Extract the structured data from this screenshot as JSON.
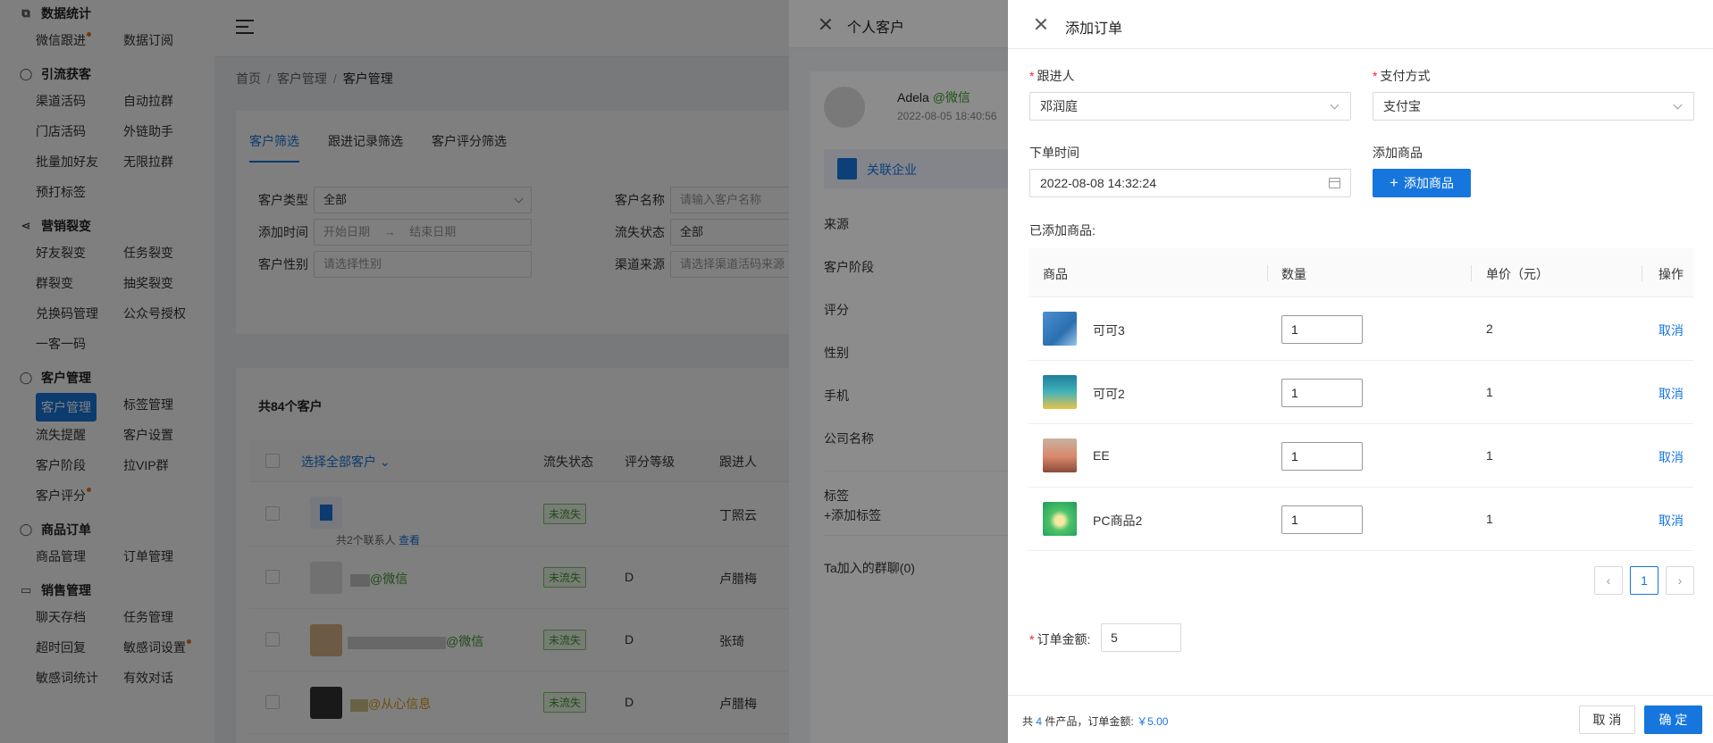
{
  "sidebar": {
    "groups": [
      {
        "title": "数据统计",
        "icon": "chart-icon",
        "items": [
          {
            "label": "微信跟进",
            "dot": true
          },
          {
            "label": "数据订阅"
          }
        ]
      },
      {
        "title": "引流获客",
        "icon": "user-icon",
        "items": [
          {
            "label": "渠道活码"
          },
          {
            "label": "自动拉群"
          },
          {
            "label": "门店活码"
          },
          {
            "label": "外链助手"
          },
          {
            "label": "批量加好友"
          },
          {
            "label": "无限拉群"
          },
          {
            "label": "预打标签"
          }
        ]
      },
      {
        "title": "营销裂变",
        "icon": "share-icon",
        "items": [
          {
            "label": "好友裂变"
          },
          {
            "label": "任务裂变"
          },
          {
            "label": "群裂变"
          },
          {
            "label": "抽奖裂变"
          },
          {
            "label": "兑换码管理"
          },
          {
            "label": "公众号授权"
          },
          {
            "label": "一客一码"
          }
        ]
      },
      {
        "title": "客户管理",
        "icon": "user-icon",
        "items": [
          {
            "label": "客户管理",
            "active": true
          },
          {
            "label": "标签管理"
          },
          {
            "label": "流失提醒"
          },
          {
            "label": "客户设置"
          },
          {
            "label": "客户阶段"
          },
          {
            "label": "拉VIP群"
          },
          {
            "label": "客户评分",
            "dot": true
          }
        ]
      },
      {
        "title": "商品订单",
        "icon": "user-icon",
        "items": [
          {
            "label": "商品管理"
          },
          {
            "label": "订单管理"
          }
        ]
      },
      {
        "title": "销售管理",
        "icon": "monitor-icon",
        "items": [
          {
            "label": "聊天存档"
          },
          {
            "label": "任务管理"
          },
          {
            "label": "超时回复"
          },
          {
            "label": "敏感词设置",
            "dot": true
          },
          {
            "label": "敏感词统计"
          },
          {
            "label": "有效对话"
          }
        ]
      }
    ]
  },
  "breadcrumb": {
    "home": "首页",
    "sep": "/",
    "level1": "客户管理",
    "current": "客户管理"
  },
  "filter": {
    "tabs": [
      "客户筛选",
      "跟进记录筛选",
      "客户评分筛选"
    ],
    "customer_type_label": "客户类型",
    "customer_type_value": "全部",
    "customer_name_label": "客户名称",
    "customer_name_placeholder": "请输入客户名称",
    "add_time_label": "添加时间",
    "start_placeholder": "开始日期",
    "range_arrow": "→",
    "end_placeholder": "结束日期",
    "churn_label": "流失状态",
    "churn_value": "全部",
    "gender_label": "客户性别",
    "gender_placeholder": "请选择性别",
    "channel_label": "渠道来源",
    "channel_placeholder": "请选择渠道活码来源"
  },
  "list": {
    "title": "共84个客户",
    "headers": {
      "select_all": "选择全部客户",
      "churn": "流失状态",
      "grade": "评分等级",
      "follower": "跟进人"
    },
    "rows": [
      {
        "contacts": "共2个联系人",
        "view": "查看",
        "status": "未流失",
        "grade": "",
        "follower": "丁照云"
      },
      {
        "name": "@微信",
        "status": "未流失",
        "grade": "D",
        "follower": "卢腊梅"
      },
      {
        "name": "@微信",
        "status": "未流失",
        "grade": "D",
        "follower": "张琦"
      },
      {
        "name": "@从心信息",
        "status": "未流失",
        "grade": "D",
        "follower": "卢腊梅"
      }
    ]
  },
  "customer_drawer": {
    "title": "个人客户",
    "name": "Adela",
    "source_tag": "@微信",
    "time": "2022-08-05 18:40:56",
    "corp_link": "关联企业",
    "fields": [
      "来源",
      "客户阶段",
      "评分",
      "性别",
      "手机",
      "公司名称"
    ],
    "tags_label": "标签",
    "add_tag": "+添加标签",
    "groups": "Ta加入的群聊(0)"
  },
  "order_drawer": {
    "title": "添加订单",
    "follower_label": "跟进人",
    "follower_value": "邓润庭",
    "payment_label": "支付方式",
    "payment_value": "支付宝",
    "order_time_label": "下单时间",
    "order_time_value": "2022-08-08 14:32:24",
    "add_goods_label": "添加商品",
    "add_goods_button": "添加商品",
    "added_label": "已添加商品:",
    "table_headers": {
      "goods": "商品",
      "qty": "数量",
      "price": "单价（元）",
      "action": "操作"
    },
    "items": [
      {
        "name": "可可3",
        "qty": "1",
        "price": "2",
        "action": "取消"
      },
      {
        "name": "可可2",
        "qty": "1",
        "price": "1",
        "action": "取消"
      },
      {
        "name": "EE",
        "qty": "1",
        "price": "1",
        "action": "取消"
      },
      {
        "name": "PC商品2",
        "qty": "1",
        "price": "1",
        "action": "取消"
      }
    ],
    "page": "1",
    "amount_label": "订单金额:",
    "amount_value": "5",
    "summary_prefix": "共",
    "summary_count": "4",
    "summary_mid": "件产品，订单金额:",
    "summary_amount": "￥5.00",
    "cancel_button": "取 消",
    "confirm_button": "确 定"
  },
  "colors": {
    "primary": "#1676de",
    "success": "#3d9a2c",
    "required": "#f5222d"
  }
}
